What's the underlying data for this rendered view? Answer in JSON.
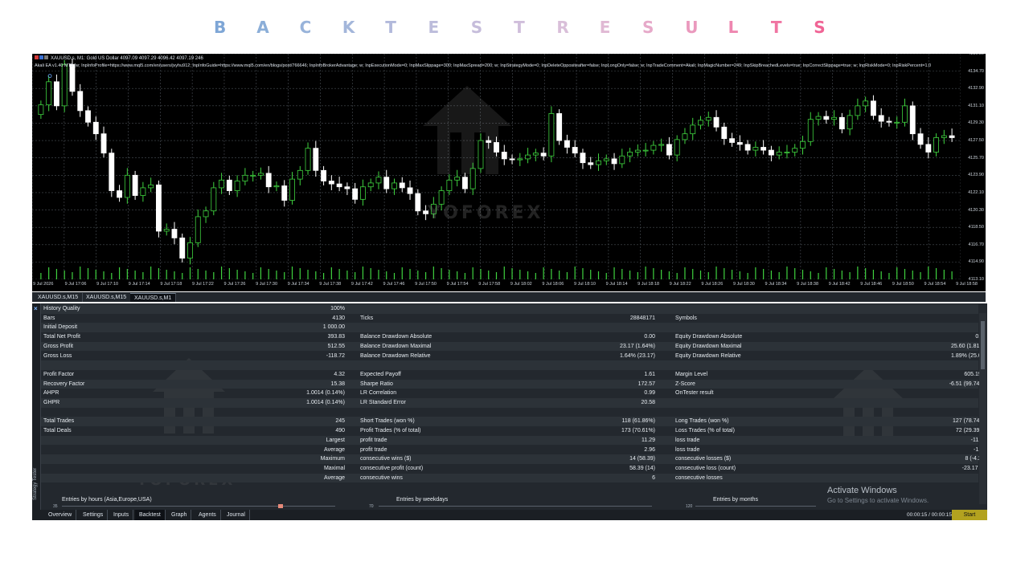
{
  "page": {
    "title_letters": [
      {
        "ch": "B",
        "color": "#7ea6d6"
      },
      {
        "ch": "A",
        "color": "#8baed8"
      },
      {
        "ch": "C",
        "color": "#98b3da"
      },
      {
        "ch": "K",
        "color": "#a3b6da"
      },
      {
        "ch": "T",
        "color": "#b2b9db"
      },
      {
        "ch": "E",
        "color": "#bcbcdb"
      },
      {
        "ch": "S",
        "color": "#c6bddb"
      },
      {
        "ch": "T",
        "color": "#d0bedb"
      },
      {
        "ch": "R",
        "color": "#d9bfd9"
      },
      {
        "ch": "E",
        "color": "#e0b9d4"
      },
      {
        "ch": "S",
        "color": "#e6a9c9"
      },
      {
        "ch": "U",
        "color": "#ea99bd"
      },
      {
        "ch": "L",
        "color": "#ee86b0"
      },
      {
        "ch": "T",
        "color": "#f075a2"
      },
      {
        "ch": "S",
        "color": "#f06495"
      }
    ]
  },
  "chart": {
    "symbol_info": "XAUUSD.s, M1:  Gold US Dollar  4097.09 4097.29 4096.42 4097.19  246",
    "params_line": "Akali EA v1.40 MT5 [w; InpInfoProfile=https://www.mql5.com/en/users/jvyhu912; InpInfoGuide=https://www.mql5.com/en/blogs/post/766646; InpInfoBrokerAdvantage; w; InpExecutionMode=0; InpMaxSlippage=300; InpMaxSpread=200; w; InpStrategyMode=0; InpDeleteOppositeafter=false; InpLongOnly=false; w; InpTradeComment=Akali; InpMagicNumber=249; InpSkipBreachedLevels=true; InpCorrectSlippage=true; w; InpRiskMode=0; InpRiskPercent=1.0",
    "watermark": "YOFOREX",
    "price_labels": [
      "4136.50",
      "4134.70",
      "4132.90",
      "4131.10",
      "4129.30",
      "4127.50",
      "4125.70",
      "4123.90",
      "4122.10",
      "4120.30",
      "4118.50",
      "4116.70",
      "4114.90",
      "4113.10"
    ],
    "time_labels": [
      "9 Jul 2026",
      "9 Jul 17:06",
      "9 Jul 17:10",
      "9 Jul 17:14",
      "9 Jul 17:18",
      "9 Jul 17:22",
      "9 Jul 17:26",
      "9 Jul 17:30",
      "9 Jul 17:34",
      "9 Jul 17:38",
      "9 Jul 17:42",
      "9 Jul 17:46",
      "9 Jul 17:50",
      "9 Jul 17:54",
      "9 Jul 17:58",
      "9 Jul 18:02",
      "9 Jul 18:06",
      "9 Jul 18:10",
      "9 Jul 18:14",
      "9 Jul 18:18",
      "9 Jul 18:22",
      "9 Jul 18:26",
      "9 Jul 18:30",
      "9 Jul 18:34",
      "9 Jul 18:38",
      "9 Jul 18:42",
      "9 Jul 18:46",
      "9 Jul 18:50",
      "9 Jul 18:54",
      "9 Jul 18:58"
    ],
    "candle_closes": [
      4131.2,
      4133.6,
      4131.1,
      4135.4,
      4132.6,
      4130.6,
      4129.4,
      4128.2,
      4126.2,
      4122.3,
      4121.6,
      4123.9,
      4121.8,
      4122.6,
      4122.9,
      4118.1,
      4118.3,
      4117.4,
      4115.3,
      4116.9,
      4119.6,
      4120.2,
      4122.6,
      4123.4,
      4122.3,
      4123.3,
      4123.9,
      4123.9,
      4124.1,
      4122.7,
      4122.8,
      4121.3,
      4123.5,
      4124.4,
      4126.7,
      4124.4,
      4123.3,
      4123.0,
      4122.7,
      4122.5,
      4121.4,
      4122.7,
      4123.1,
      4123.7,
      4122.5,
      4123.1,
      4122.6,
      4122.0,
      4120.2,
      4119.9,
      4120.9,
      4122.3,
      4123.4,
      4123.7,
      4122.5,
      4124.6,
      4127.5,
      4127.3,
      4126.3,
      4125.6,
      4125.5,
      4125.6,
      4126.0,
      4126.2,
      4125.9,
      4130.3,
      4127.5,
      4126.8,
      4126.2,
      4125.2,
      4125.0,
      4125.4,
      4125.6,
      4125.1,
      4125.9,
      4126.3,
      4126.5,
      4126.5,
      4127.0,
      4127.1,
      4126.0,
      4127.6,
      4128.2,
      4129.1,
      4129.6,
      4129.9,
      4128.9,
      4127.7,
      4127.3,
      4127.1,
      4126.5,
      4126.8,
      4126.5,
      4126.0,
      4126.3,
      4126.3,
      4126.7,
      4127.4,
      4129.7,
      4130.0,
      4129.7,
      4129.9,
      4128.7,
      4130.1,
      4131.1,
      4131.6,
      4130.1,
      4129.5,
      4129.4,
      4129.4,
      4131.1,
      4128.2,
      4127.1,
      4126.3,
      4127.8,
      4128.0,
      4127.8
    ]
  },
  "chart_tabs": [
    "XAUUSD.s,M15",
    "XAUUSD.s,M15",
    "XAUUSD.s,M1"
  ],
  "tester": {
    "side_label": "Strategy Tester",
    "rows": [
      {
        "l1": "History Quality",
        "v1": "100%",
        "l2": "",
        "v2": "",
        "l3": "",
        "v3": ""
      },
      {
        "l1": "Bars",
        "v1": "4130",
        "l2": "Ticks",
        "v2": "28848171",
        "l3": "Symbols",
        "v3": "1"
      },
      {
        "l1": "Initial Deposit",
        "v1": "1 000.00",
        "l2": "",
        "v2": "",
        "l3": "",
        "v3": ""
      },
      {
        "l1": "Total Net Profit",
        "v1": "393.83",
        "l2": "Balance Drawdown Absolute",
        "v2": "0.00",
        "l3": "Equity Drawdown Absolute",
        "v3": "0.00"
      },
      {
        "l1": "Gross Profit",
        "v1": "512.55",
        "l2": "Balance Drawdown Maximal",
        "v2": "23.17 (1.64%)",
        "l3": "Equity Drawdown Maximal",
        "v3": "25.60 (1.81%)"
      },
      {
        "l1": "Gross Loss",
        "v1": "-118.72",
        "l2": "Balance Drawdown Relative",
        "v2": "1.64% (23.17)",
        "l3": "Equity Drawdown Relative",
        "v3": "1.89% (25.09)"
      },
      {
        "l1": "",
        "v1": "",
        "l2": "",
        "v2": "",
        "l3": "",
        "v3": ""
      },
      {
        "l1": "Profit Factor",
        "v1": "4.32",
        "l2": "Expected Payoff",
        "v2": "1.61",
        "l3": "Margin Level",
        "v3": "605.19%"
      },
      {
        "l1": "Recovery Factor",
        "v1": "15.38",
        "l2": "Sharpe Ratio",
        "v2": "172.57",
        "l3": "Z-Score",
        "v3": "-6.51 (99.74%)"
      },
      {
        "l1": "AHPR",
        "v1": "1.0014 (0.14%)",
        "l2": "LR Correlation",
        "v2": "0.99",
        "l3": "OnTester result",
        "v3": "0"
      },
      {
        "l1": "GHPR",
        "v1": "1.0014 (0.14%)",
        "l2": "LR Standard Error",
        "v2": "20.58",
        "l3": "",
        "v3": ""
      },
      {
        "l1": "",
        "v1": "",
        "l2": "",
        "v2": "",
        "l3": "",
        "v3": ""
      },
      {
        "l1": "Total Trades",
        "v1": "245",
        "l2": "Short Trades (won %)",
        "v2": "118 (61.86%)",
        "l3": "Long Trades (won %)",
        "v3": "127 (78.74%)"
      },
      {
        "l1": "Total Deals",
        "v1": "490",
        "l2": "Profit Trades (% of total)",
        "v2": "173 (70.61%)",
        "l3": "Loss Trades (% of total)",
        "v3": "72 (29.39%)"
      },
      {
        "l1": "",
        "v1": "Largest",
        "l2": "profit trade",
        "v2": "11.29",
        "l3": "loss trade",
        "v3": "-11.63"
      },
      {
        "l1": "",
        "v1": "Average",
        "l2": "profit trade",
        "v2": "2.96",
        "l3": "loss trade",
        "v3": "-1.65"
      },
      {
        "l1": "",
        "v1": "Maximum",
        "l2": "consecutive wins ($)",
        "v2": "14 (58.39)",
        "l3": "consecutive losses ($)",
        "v3": "8 (-4.22)"
      },
      {
        "l1": "",
        "v1": "Maximal",
        "l2": "consecutive profit (count)",
        "v2": "58.39 (14)",
        "l3": "consecutive loss (count)",
        "v3": "-23.17 (4)"
      },
      {
        "l1": "",
        "v1": "Average",
        "l2": "consecutive wins",
        "v2": "6",
        "l3": "consecutive losses",
        "v3": "2"
      }
    ],
    "mini_charts": [
      {
        "title": "Entries by hours (Asia,Europe,USA)",
        "axis": "35"
      },
      {
        "title": "Entries by weekdays",
        "axis": "70"
      },
      {
        "title": "Entries by months",
        "axis": "120"
      }
    ],
    "watermark": "YOFOREX",
    "activate_title": "Activate Windows",
    "activate_sub": "Go to Settings to activate Windows."
  },
  "bottom_tabs": [
    "Overview",
    "Settings",
    "Inputs",
    "Backtest",
    "Graph",
    "Agents",
    "Journal"
  ],
  "bottom_active": 3,
  "timer": "00:00:15 / 00:00:15",
  "start_label": "Start",
  "colors": {
    "bull": "#3fd23f",
    "bear": "#ffffff",
    "quality": "#6fd86a",
    "start": "#b3a21f"
  }
}
